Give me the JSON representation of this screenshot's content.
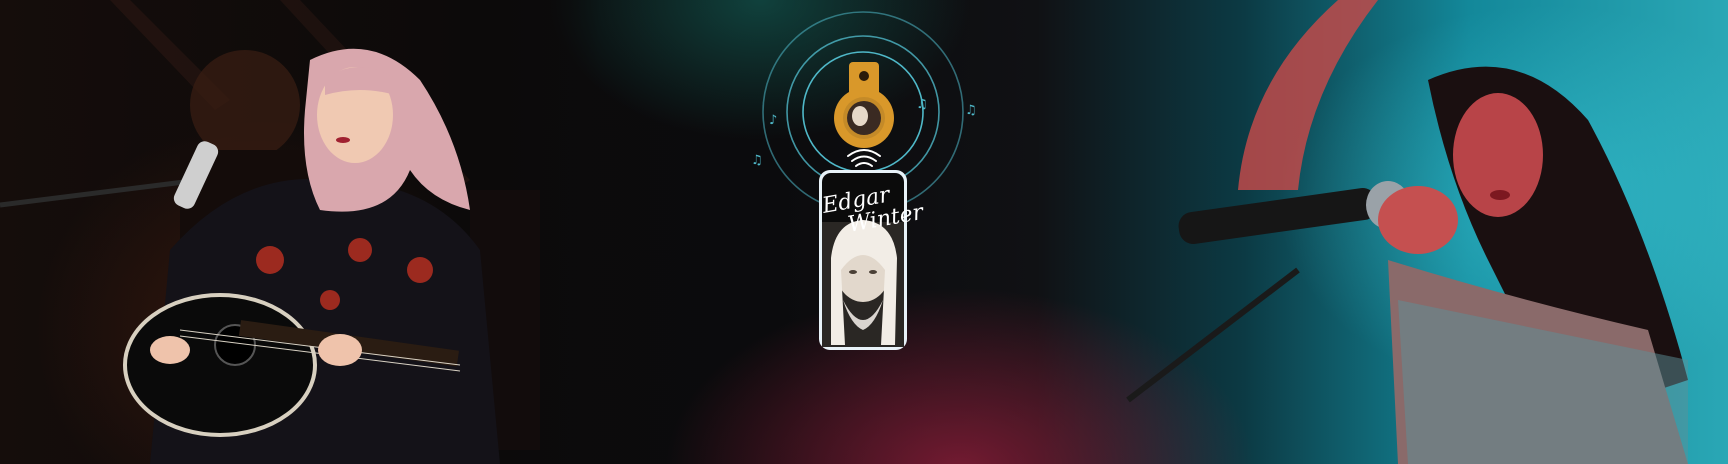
{
  "phone": {
    "name_line1": "Edgar",
    "name_line2": "Winter"
  },
  "colors": {
    "accent_teal": "#4fb8c8",
    "tag_gold": "#d9982a",
    "glow_red": "#a8203c"
  },
  "icons": [
    "music-note-icon",
    "nfc-signal-icon",
    "key-tag-icon"
  ]
}
